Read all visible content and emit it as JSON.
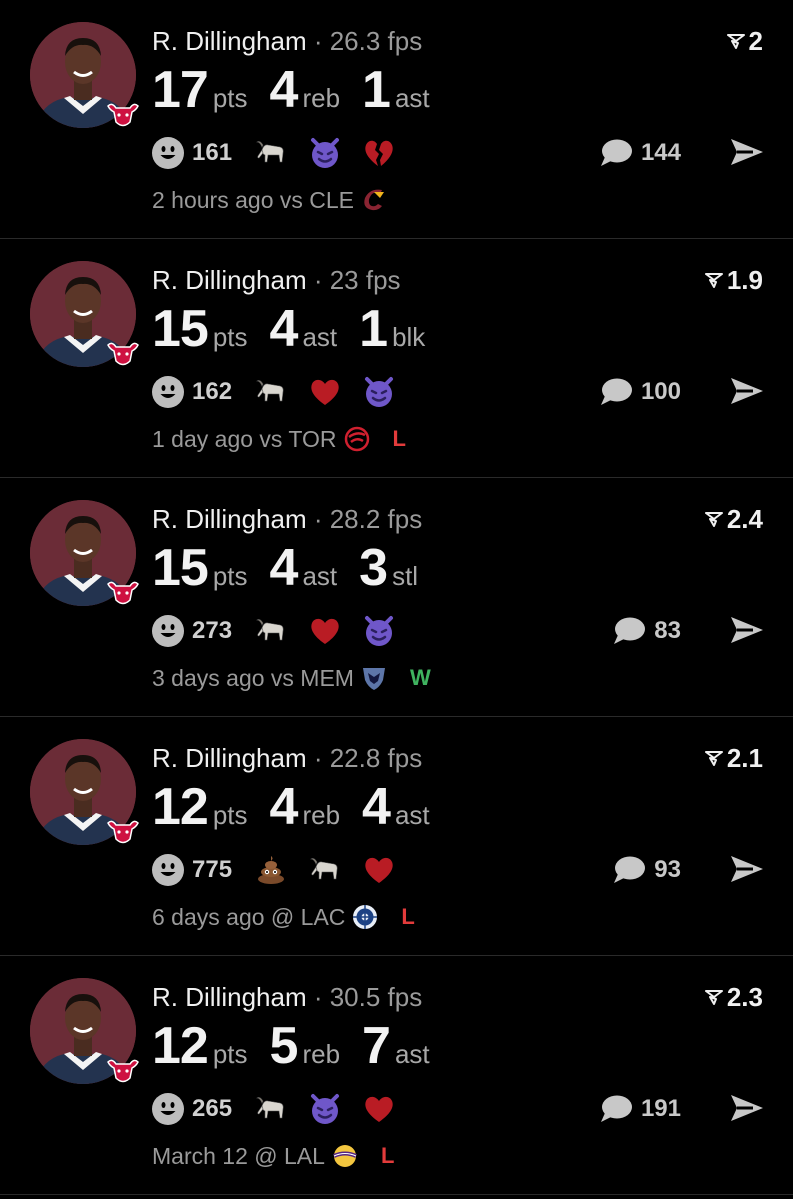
{
  "colors": {
    "background": "#000000",
    "loss": "#e23b3b",
    "win": "#3fb35f",
    "avatar_bg": "#6b2c37"
  },
  "cards": [
    {
      "player": "R. Dillingham",
      "fps": "26.3 fps",
      "rating": "2",
      "stats": [
        {
          "num": "17",
          "label": "pts"
        },
        {
          "num": "4",
          "label": "reb"
        },
        {
          "num": "1",
          "label": "ast"
        }
      ],
      "reaction_count": "161",
      "emojis": [
        "goat-icon",
        "devil-icon",
        "broken-heart-icon"
      ],
      "comment_count": "144",
      "meta": "2 hours ago vs CLE",
      "opponent_logo": "cavaliers-logo-icon",
      "result": ""
    },
    {
      "player": "R. Dillingham",
      "fps": "23 fps",
      "rating": "1.9",
      "stats": [
        {
          "num": "15",
          "label": "pts"
        },
        {
          "num": "4",
          "label": "ast"
        },
        {
          "num": "1",
          "label": "blk"
        }
      ],
      "reaction_count": "162",
      "emojis": [
        "goat-icon",
        "heart-icon",
        "devil-icon"
      ],
      "comment_count": "100",
      "meta": "1 day ago vs TOR",
      "opponent_logo": "raptors-logo-icon",
      "result": "L"
    },
    {
      "player": "R. Dillingham",
      "fps": "28.2 fps",
      "rating": "2.4",
      "stats": [
        {
          "num": "15",
          "label": "pts"
        },
        {
          "num": "4",
          "label": "ast"
        },
        {
          "num": "3",
          "label": "stl"
        }
      ],
      "reaction_count": "273",
      "emojis": [
        "goat-icon",
        "heart-icon",
        "devil-icon"
      ],
      "comment_count": "83",
      "meta": "3 days ago vs MEM",
      "opponent_logo": "grizzlies-logo-icon",
      "result": "W"
    },
    {
      "player": "R. Dillingham",
      "fps": "22.8 fps",
      "rating": "2.1",
      "stats": [
        {
          "num": "12",
          "label": "pts"
        },
        {
          "num": "4",
          "label": "reb"
        },
        {
          "num": "4",
          "label": "ast"
        }
      ],
      "reaction_count": "775",
      "emojis": [
        "poop-icon",
        "goat-icon",
        "heart-icon"
      ],
      "comment_count": "93",
      "meta": "6 days ago @ LAC",
      "opponent_logo": "clippers-logo-icon",
      "result": "L"
    },
    {
      "player": "R. Dillingham",
      "fps": "30.5 fps",
      "rating": "2.3",
      "stats": [
        {
          "num": "12",
          "label": "pts"
        },
        {
          "num": "5",
          "label": "reb"
        },
        {
          "num": "7",
          "label": "ast"
        }
      ],
      "reaction_count": "265",
      "emojis": [
        "goat-icon",
        "devil-icon",
        "heart-icon"
      ],
      "comment_count": "191",
      "meta": "March 12 @ LAL",
      "opponent_logo": "lakers-logo-icon",
      "result": "L"
    }
  ]
}
